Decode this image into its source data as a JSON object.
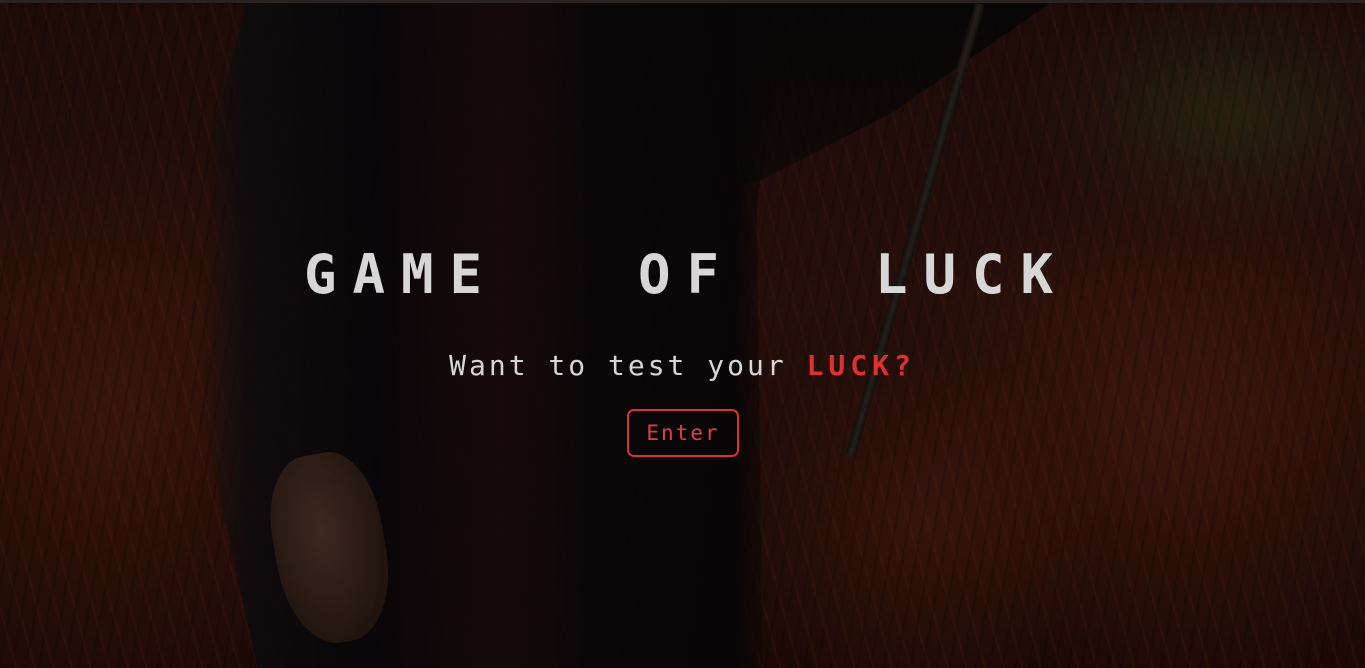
{
  "hero": {
    "title_words": [
      "GAME",
      "OF",
      "LUCK"
    ],
    "tagline_prefix": "Want to test your ",
    "tagline_accent": "LUCK?",
    "enter_label": "Enter"
  },
  "colors": {
    "title": "#d7d7d7",
    "accent": "#e0302e",
    "button_border": "#d8342f"
  }
}
